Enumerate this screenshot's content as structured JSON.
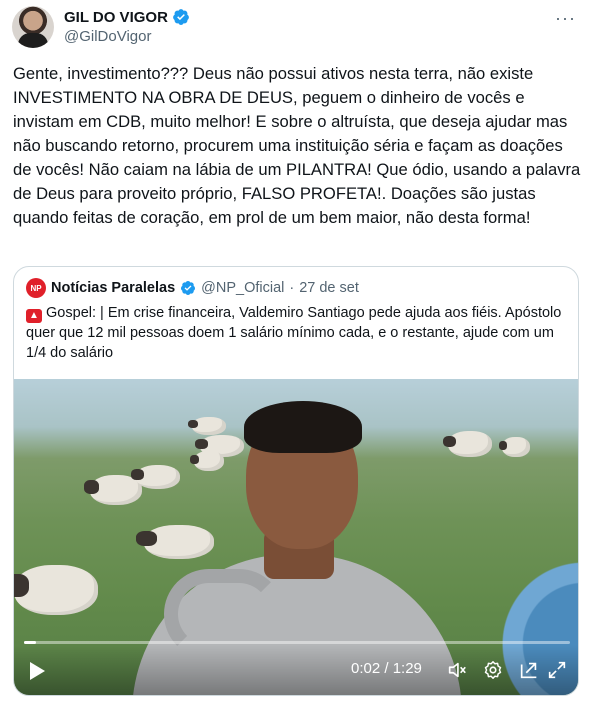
{
  "author": {
    "display_name": "GIL DO VIGOR",
    "handle": "@GilDoVigor",
    "more_icon": "more-horizontal-icon"
  },
  "tweet": {
    "text": "Gente, investimento??? Deus não possui ativos nesta terra, não existe INVESTIMENTO NA OBRA DE DEUS, peguem o dinheiro de vocês e invistam em CDB, muito melhor! E sobre o altruísta, que deseja ajudar mas não buscando retorno, procurem uma instituição séria e façam as doações de vocês! Não caiam na lábia de um PILANTRA! Que ódio, usando a palavra de Deus para proveito próprio, FALSO PROFETA!. Doações são justas quando feitas de coração, em prol de um bem maior, não desta forma!"
  },
  "quote": {
    "logo_text": "NP",
    "display_name": "Notícias Paralelas",
    "handle": "@NP_Oficial",
    "separator": "·",
    "date": "27 de set",
    "text": "Gospel: |  Em crise financeira, Valdemiro Santiago pede ajuda aos fiéis. Apóstolo quer que 12 mil pessoas doem 1 salário mínimo cada, e o restante, ajude com um 1/4 do salário",
    "emoji_icon": "siren-icon"
  },
  "video": {
    "time": "0:02 / 1:29",
    "progress_fraction": 0.022
  },
  "colors": {
    "verified": "#1d9bf0",
    "text": "#0f1419",
    "secondary": "#536471",
    "border": "#cfd9de",
    "np_red": "#e0202a"
  }
}
